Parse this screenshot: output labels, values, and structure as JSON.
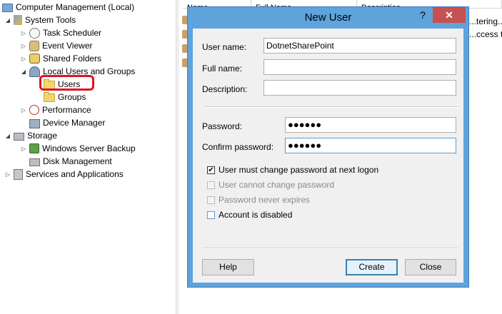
{
  "tree": {
    "items": [
      {
        "label": "Computer Management (Local)"
      },
      {
        "label": "System Tools"
      },
      {
        "label": "Task Scheduler"
      },
      {
        "label": "Event Viewer"
      },
      {
        "label": "Shared Folders"
      },
      {
        "label": "Local Users and Groups"
      },
      {
        "label": "Users"
      },
      {
        "label": "Groups"
      },
      {
        "label": "Performance"
      },
      {
        "label": "Device Manager"
      },
      {
        "label": "Storage"
      },
      {
        "label": "Windows Server Backup"
      },
      {
        "label": "Disk Management"
      },
      {
        "label": "Services and Applications"
      }
    ]
  },
  "list": {
    "columns": [
      "Name",
      "Full Name",
      "Description"
    ],
    "peek_rows": [
      "...tering...",
      "...ccess t..."
    ]
  },
  "dialog": {
    "title": "New User",
    "help_glyph": "?",
    "close_glyph": "✕",
    "fields": {
      "user_name": {
        "label": "User name:",
        "value": "DotnetSharePoint"
      },
      "full_name": {
        "label": "Full name:",
        "value": ""
      },
      "description": {
        "label": "Description:",
        "value": ""
      },
      "password": {
        "label": "Password:",
        "value": "●●●●●●"
      },
      "confirm_password": {
        "label": "Confirm password:",
        "value": "●●●●●●"
      }
    },
    "checkboxes": [
      {
        "label": "User must change password at next logon",
        "checked": true,
        "enabled": true
      },
      {
        "label": "User cannot change password",
        "checked": false,
        "enabled": false
      },
      {
        "label": "Password never expires",
        "checked": false,
        "enabled": false
      },
      {
        "label": "Account is disabled",
        "checked": false,
        "enabled": true
      }
    ],
    "buttons": {
      "help": "Help",
      "create": "Create",
      "close": "Close"
    }
  }
}
